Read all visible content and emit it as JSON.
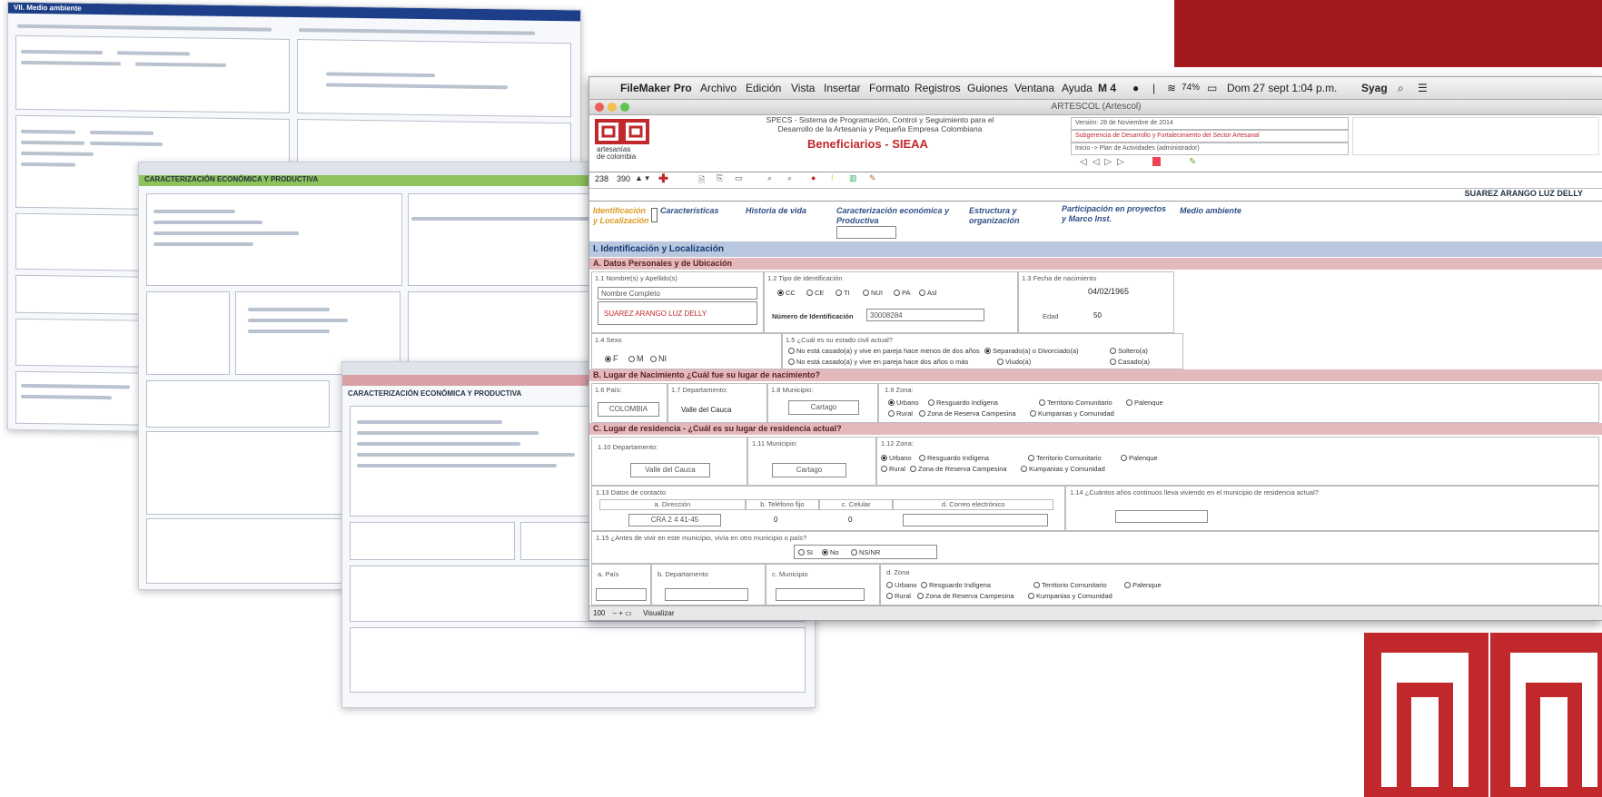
{
  "menubar": {
    "app": "FileMaker Pro",
    "items": [
      "Archivo",
      "Edición",
      "Vista",
      "Insertar",
      "Formato",
      "Registros",
      "Guiones",
      "Ventana",
      "Ayuda"
    ],
    "status": {
      "wifi": "74%",
      "clock": "Dom 27 sept 1:04 p.m.",
      "user": "Syag"
    }
  },
  "window": {
    "title": "ARTESCOL (Artescol)"
  },
  "header": {
    "logo_text_1": "artesanías",
    "logo_text_2": "de colombia",
    "system_line_1": "SPECS - Sistema de Programación, Control y Seguimiento para el",
    "system_line_2": "Desarrollo de la Artesanía y Pequeña Empresa Colombiana",
    "title": "Beneficiarios - SIEAA",
    "right_1": "Versión: 28 de Noviembre de 2014",
    "right_2": "Subgerencia de Desarrollo y Fortalecimiento del Sector Artesanal",
    "right_3": "Inicio -> Plan de Actividades (administrador)",
    "beneficiary_name": "SUAREZ ARANGO  LUZ DELLY"
  },
  "toolbar": {
    "record": "238",
    "found": "390"
  },
  "tabs": [
    "Identificación y Localización",
    "Características",
    "Historia de vida",
    "Caracterización económica y Productiva",
    "Estructura y organización",
    "Participación en proyectos y Marco Inst.",
    "Medio ambiente"
  ],
  "section_1": "I. Identificación y Localización",
  "section_a": "A. Datos Personales y de Ubicación",
  "personal": {
    "l_name": "1.1 Nombre(s) y Apellido(s)",
    "name_caption": "Nombre Completo",
    "name_value": "SUAREZ ARANGO  LUZ DELLY",
    "l_id_type": "1.2 Tipo de identificación",
    "id_types": [
      "CC",
      "CE",
      "TI",
      "NUI",
      "PA",
      "Asl"
    ],
    "l_id_number": "Número de Identificación",
    "id_number": "30008284",
    "l_birth": "1.3 Fecha de nacimiento",
    "birth": "04/02/1965",
    "l_age": "Edad",
    "age": "50",
    "l_sex": "1.4 Sexo",
    "sex": [
      "F",
      "M",
      "NI"
    ],
    "l_civil": "1.5 ¿Cuál es su estado civil actual?",
    "civil_1": "No está casado(a) y vive en pareja hace menos de dos años",
    "civil_2": "No está casado(a) y vive en pareja hace dos años o más",
    "civil_3": "Separado(a) o Divorciado(a)",
    "civil_4": "Viudo(a)",
    "civil_5": "Soltero(a)",
    "civil_6": "Casado(a)"
  },
  "section_b": "B. Lugar de Nacimiento ¿Cuál fue su lugar de nacimiento?",
  "birth_place": {
    "l_country": "1.6 País:",
    "country": "COLOMBIA",
    "l_dept": "1.7 Departamento:",
    "dept": "Valle del Cauca",
    "l_muni": "1.8 Municipio:",
    "muni": "Cartago",
    "l_zone": "1.9 Zona:"
  },
  "zones": {
    "urbano": "Urbano",
    "resguardo": "Resguardo Indígena",
    "territorio": "Territorio Comunitario",
    "palenque": "Palenque",
    "rural": "Rural",
    "reserva": "Zona de Reserva Campesina",
    "kumpanias": "Kumpanias y Comunidad"
  },
  "section_c": "C. Lugar de residencia - ¿Cuál es su lugar de residencia actual?",
  "residence": {
    "l_dept": "1.10 Departamento:",
    "dept": "Valle del Cauca",
    "l_muni": "1.11 Municipio:",
    "muni": "Cartago",
    "l_zone": "1.12 Zona:",
    "l_contact": "1.13 Datos de contacto",
    "c_dir": "a. Dirección",
    "c_tel": "b. Teléfono fijo",
    "c_cel": "c. Celular",
    "c_mail": "d. Correo electrónico",
    "dir": "CRA 2 4 41-45",
    "tel": "0",
    "cel": "0",
    "l_years": "1.14 ¿Cuántos años continuos lleva viviendo en el municipio de residencia actual?",
    "l_before": "1.15 ¿Antes de vivir en este municipio, vivía en otro municipio o país?",
    "before_opts": [
      "SI",
      "No",
      "NS/NR"
    ],
    "l_pais": "a. País",
    "l_b_dept": "b. Departamento",
    "l_b_muni": "c. Municipio",
    "l_b_zona": "d. Zona"
  },
  "statusbar": {
    "zoom": "100",
    "mode": "Visualizar"
  },
  "background": {
    "shot1_title": "VII. Medio ambiente",
    "shot2_title": "CARACTERIZACIÓN ECONÓMICA Y PRODUCTIVA",
    "shot3_title": "CARACTERIZACIÓN ECONÓMICA Y PRODUCTIVA"
  }
}
